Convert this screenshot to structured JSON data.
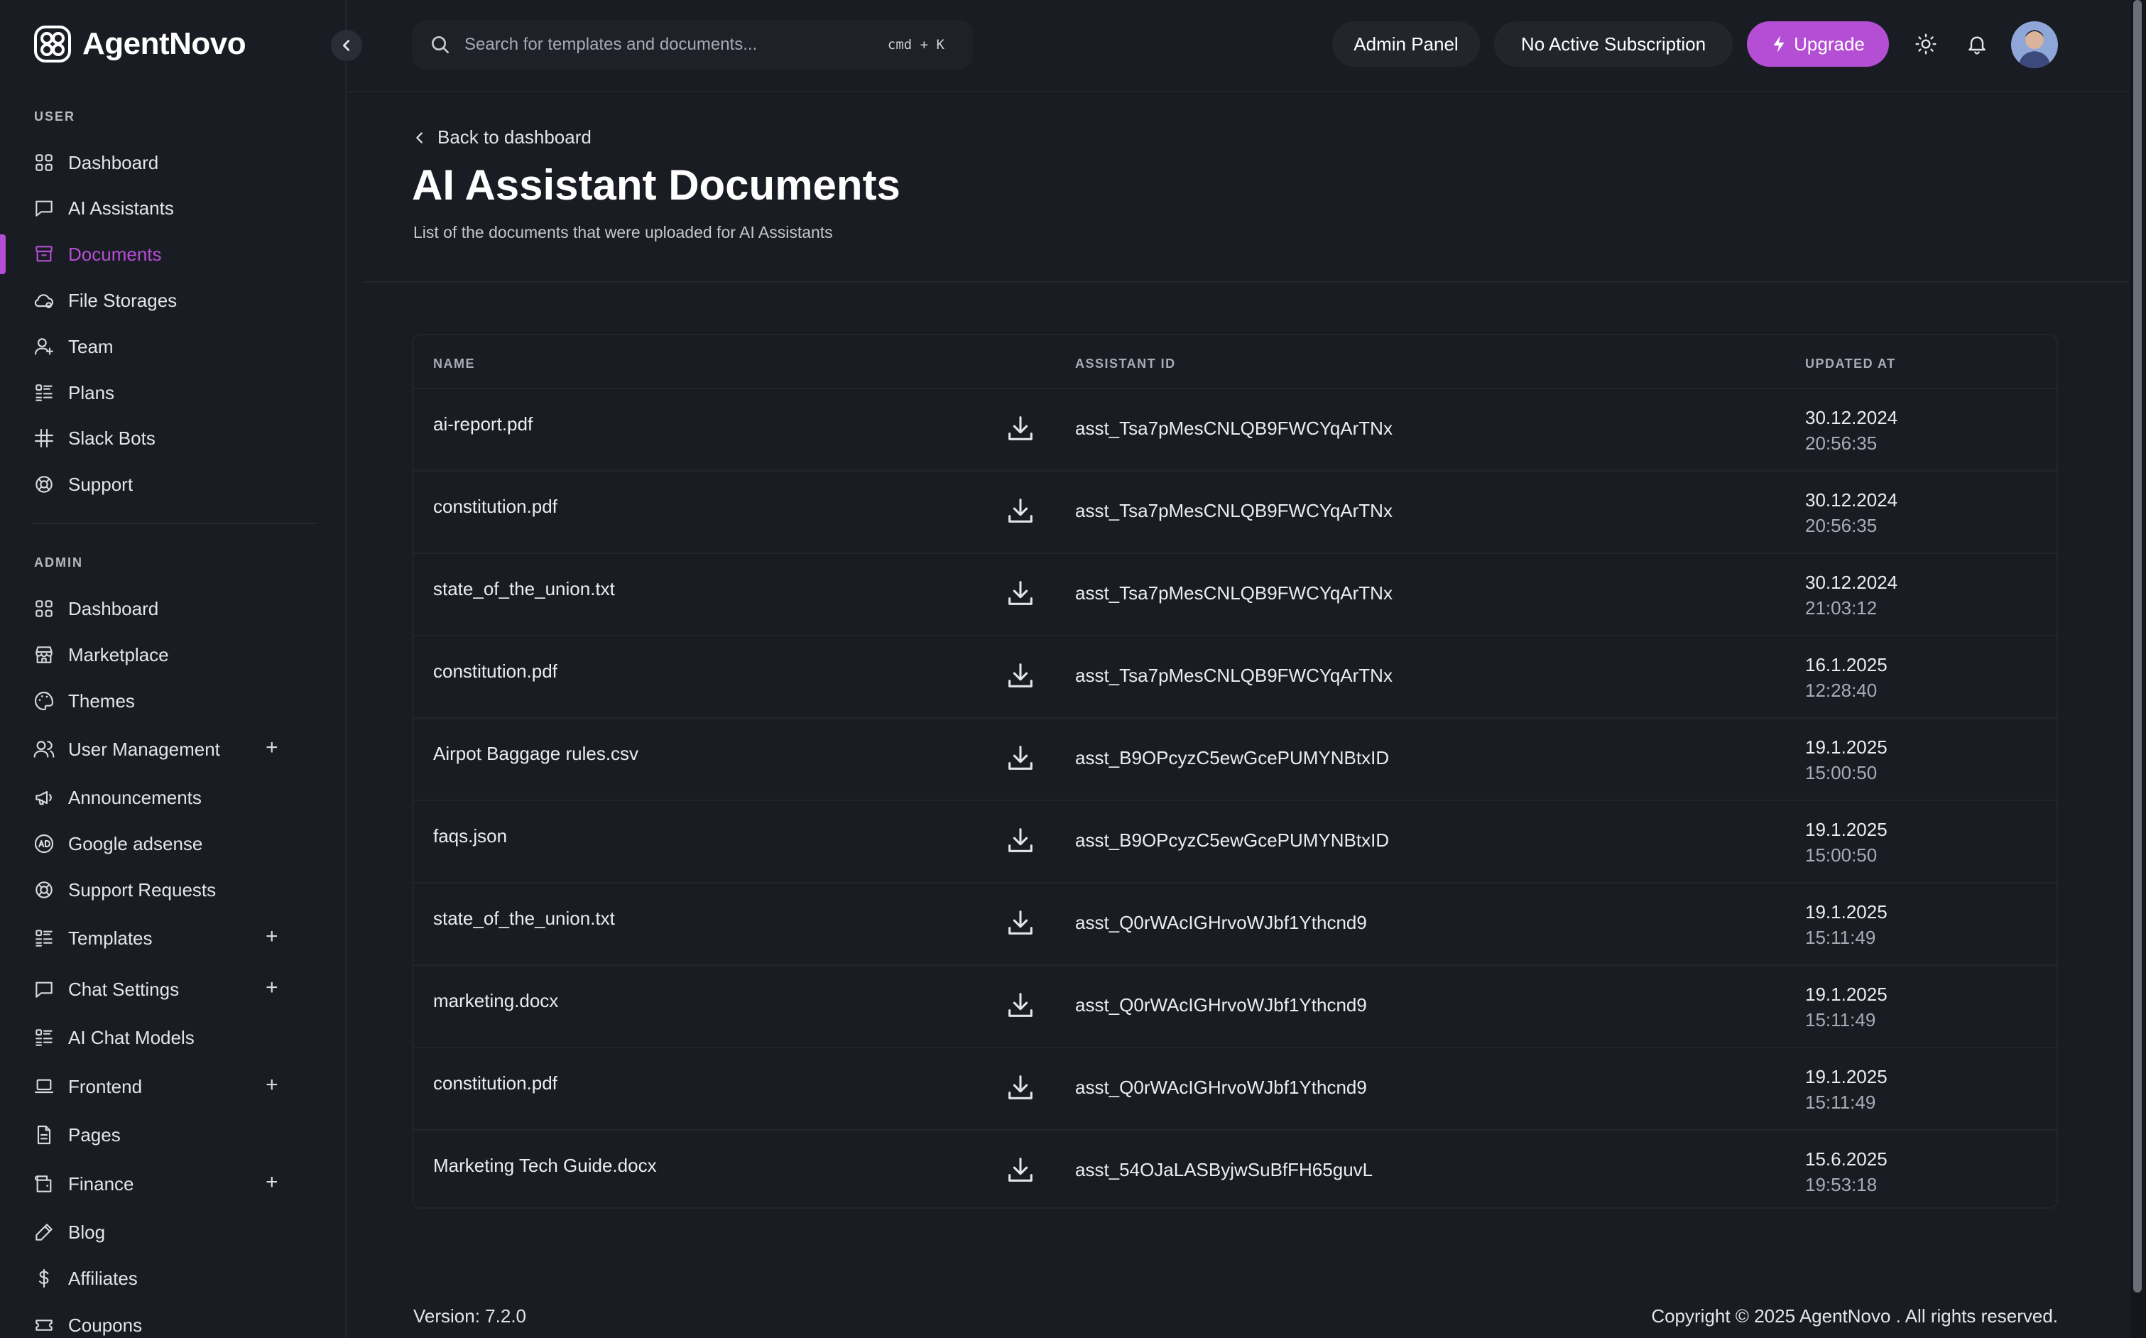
{
  "app": {
    "name": "AgentNovo"
  },
  "search": {
    "placeholder": "Search for templates and documents...",
    "shortcut": "cmd + K"
  },
  "header": {
    "admin_panel": "Admin Panel",
    "subscription": "No Active Subscription",
    "upgrade": "Upgrade"
  },
  "sidebar": {
    "user_label": "USER",
    "admin_label": "ADMIN",
    "user_items": [
      {
        "label": "Dashboard",
        "icon": "grid-icon"
      },
      {
        "label": "AI Assistants",
        "icon": "chat-icon"
      },
      {
        "label": "Documents",
        "icon": "archive-icon"
      },
      {
        "label": "File Storages",
        "icon": "cloud-icon"
      },
      {
        "label": "Team",
        "icon": "user-plus-icon"
      },
      {
        "label": "Plans",
        "icon": "list-icon"
      },
      {
        "label": "Slack Bots",
        "icon": "slack-icon"
      },
      {
        "label": "Support",
        "icon": "lifebuoy-icon"
      }
    ],
    "admin_items": [
      {
        "label": "Dashboard",
        "icon": "grid-icon"
      },
      {
        "label": "Marketplace",
        "icon": "store-icon"
      },
      {
        "label": "Themes",
        "icon": "palette-icon"
      },
      {
        "label": "User Management",
        "icon": "users-icon"
      },
      {
        "label": "Announcements",
        "icon": "megaphone-icon"
      },
      {
        "label": "Google adsense",
        "icon": "ad-icon"
      },
      {
        "label": "Support Requests",
        "icon": "lifebuoy-icon"
      },
      {
        "label": "Templates",
        "icon": "list-icon"
      },
      {
        "label": "Chat Settings",
        "icon": "chat-icon"
      },
      {
        "label": "AI Chat Models",
        "icon": "list-icon"
      },
      {
        "label": "Frontend",
        "icon": "laptop-icon"
      },
      {
        "label": "Pages",
        "icon": "document-icon"
      },
      {
        "label": "Finance",
        "icon": "wallet-icon"
      },
      {
        "label": "Blog",
        "icon": "pencil-icon"
      },
      {
        "label": "Affiliates",
        "icon": "dollar-icon"
      },
      {
        "label": "Coupons",
        "icon": "ticket-icon"
      }
    ]
  },
  "page": {
    "back_label": "Back to dashboard",
    "title": "AI Assistant Documents",
    "subtitle": "List of the documents that were uploaded for AI Assistants"
  },
  "table": {
    "headers": {
      "name": "NAME",
      "assistant_id": "ASSISTANT ID",
      "updated_at": "UPDATED AT"
    },
    "rows": [
      {
        "name": "ai-report.pdf",
        "assistant_id": "asst_Tsa7pMesCNLQB9FWCYqArTNx",
        "date": "30.12.2024",
        "time": "20:56:35"
      },
      {
        "name": "constitution.pdf",
        "assistant_id": "asst_Tsa7pMesCNLQB9FWCYqArTNx",
        "date": "30.12.2024",
        "time": "20:56:35"
      },
      {
        "name": "state_of_the_union.txt",
        "assistant_id": "asst_Tsa7pMesCNLQB9FWCYqArTNx",
        "date": "30.12.2024",
        "time": "21:03:12"
      },
      {
        "name": "constitution.pdf",
        "assistant_id": "asst_Tsa7pMesCNLQB9FWCYqArTNx",
        "date": "16.1.2025",
        "time": "12:28:40"
      },
      {
        "name": "Airpot Baggage rules.csv",
        "assistant_id": "asst_B9OPcyzC5ewGcePUMYNBtxID",
        "date": "19.1.2025",
        "time": "15:00:50"
      },
      {
        "name": "faqs.json",
        "assistant_id": "asst_B9OPcyzC5ewGcePUMYNBtxID",
        "date": "19.1.2025",
        "time": "15:00:50"
      },
      {
        "name": "state_of_the_union.txt",
        "assistant_id": "asst_Q0rWAcIGHrvoWJbf1Ythcnd9",
        "date": "19.1.2025",
        "time": "15:11:49"
      },
      {
        "name": "marketing.docx",
        "assistant_id": "asst_Q0rWAcIGHrvoWJbf1Ythcnd9",
        "date": "19.1.2025",
        "time": "15:11:49"
      },
      {
        "name": "constitution.pdf",
        "assistant_id": "asst_Q0rWAcIGHrvoWJbf1Ythcnd9",
        "date": "19.1.2025",
        "time": "15:11:49"
      },
      {
        "name": "Marketing Tech Guide.docx",
        "assistant_id": "asst_54OJaLASByjwSuBfFH65guvL",
        "date": "15.6.2025",
        "time": "19:53:18"
      }
    ]
  },
  "footer": {
    "version": "Version: 7.2.0",
    "copyright": "Copyright © 2025 AgentNovo . All rights reserved."
  },
  "colors": {
    "accent": "#b44ed4",
    "background": "#1a1c23",
    "surface": "#23252d"
  }
}
